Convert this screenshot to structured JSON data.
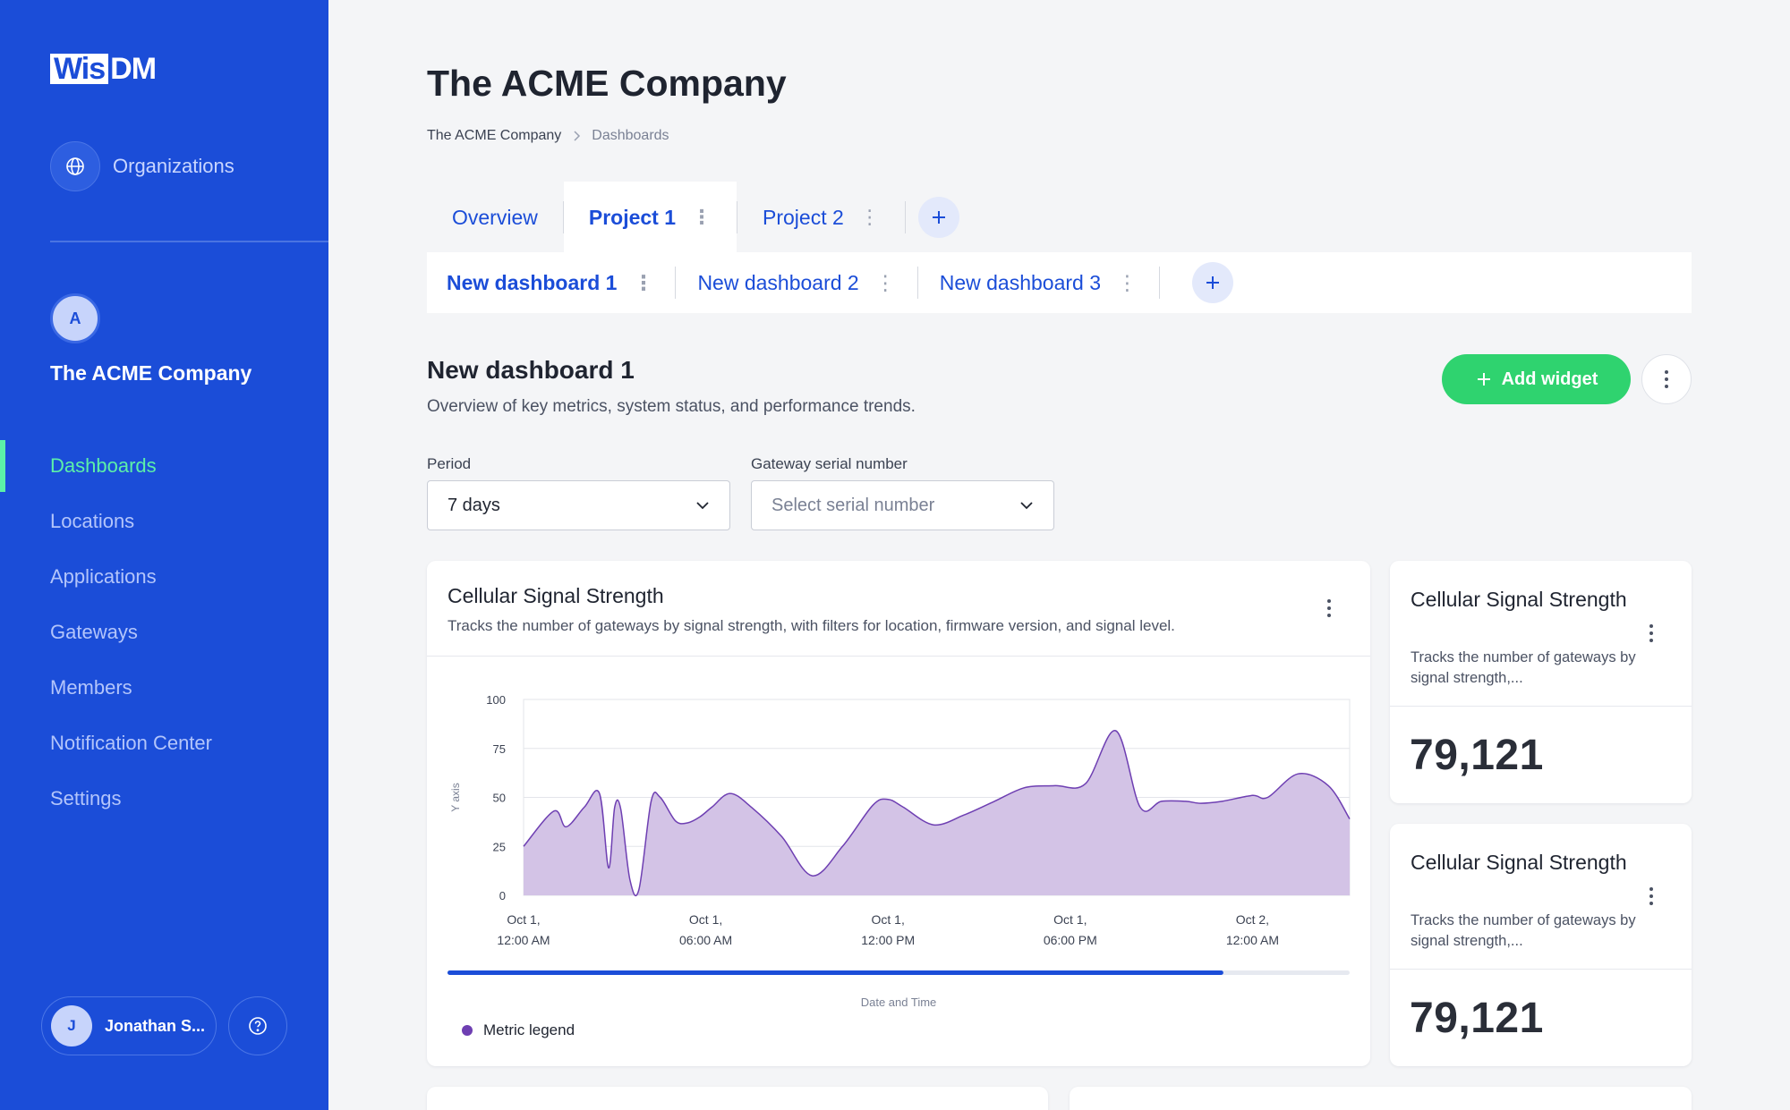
{
  "sidebar": {
    "logo_box": "Wis",
    "logo_rest": "DM",
    "organizations_label": "Organizations",
    "company_initial": "A",
    "company_name": "The ACME Company",
    "nav": [
      {
        "label": "Dashboards",
        "active": true
      },
      {
        "label": "Locations"
      },
      {
        "label": "Applications"
      },
      {
        "label": "Gateways"
      },
      {
        "label": "Members"
      },
      {
        "label": "Notification Center"
      },
      {
        "label": "Settings"
      }
    ],
    "user_initial": "J",
    "user_name": "Jonathan S..."
  },
  "header": {
    "title": "The ACME Company",
    "breadcrumb": [
      "The ACME Company",
      "Dashboards"
    ]
  },
  "tabs": [
    {
      "label": "Overview"
    },
    {
      "label": "Project 1",
      "active": true
    },
    {
      "label": "Project 2"
    }
  ],
  "subtabs": [
    {
      "label": "New dashboard 1",
      "active": true
    },
    {
      "label": "New dashboard 2"
    },
    {
      "label": "New dashboard 3"
    }
  ],
  "dashboard": {
    "title": "New dashboard 1",
    "description": "Overview of key metrics, system status, and performance trends.",
    "add_widget_label": "Add widget"
  },
  "filters": {
    "period_label": "Period",
    "period_value": "7 days",
    "gateway_label": "Gateway serial number",
    "gateway_placeholder": "Select serial number"
  },
  "chart_widget": {
    "title": "Cellular Signal Strength",
    "description": "Tracks the number of gateways by signal strength, with filters for location, firmware version, and signal level.",
    "legend_label": "Metric legend"
  },
  "stat_widgets": [
    {
      "title": "Cellular Signal Strength",
      "description": "Tracks the number of gateways by signal strength,...",
      "value": "79,121"
    },
    {
      "title": "Cellular Signal Strength",
      "description": "Tracks the number of gateways by signal strength,...",
      "value": "79,121"
    }
  ],
  "colors": {
    "brand": "#1b4dd8",
    "accent_green": "#2fd36f",
    "active_nav": "#5cf0a8",
    "series_fill": "#d3c3e6",
    "series_line": "#6e3fb2"
  },
  "chart_data": {
    "type": "area",
    "xlabel": "Date and Time",
    "ylabel": "Y axis",
    "ylim": [
      0,
      100
    ],
    "yticks": [
      0,
      25,
      50,
      75,
      100
    ],
    "xtick_labels": [
      [
        "Oct 1,",
        "12:00 AM"
      ],
      [
        "Oct 1,",
        "06:00 AM"
      ],
      [
        "Oct 1,",
        "12:00 PM"
      ],
      [
        "Oct 1,",
        "06:00 PM"
      ],
      [
        "Oct 2,",
        "12:00 AM"
      ]
    ],
    "xlim_hours": [
      0,
      27.2
    ],
    "scrollbar_fraction": 0.86,
    "series": [
      {
        "name": "Metric legend",
        "x": [
          0,
          1,
          1.4,
          2,
          2.5,
          2.8,
          3,
          3.2,
          3.5,
          3.8,
          4.2,
          4.5,
          5,
          5.4,
          5.8,
          6.2,
          6.8,
          7.5,
          8.5,
          9.5,
          10.5,
          11.5,
          12,
          12.5,
          13.5,
          14.5,
          15.5,
          16.5,
          17.5,
          18.5,
          19.5,
          20.3,
          21,
          21.8,
          22.3,
          23,
          24,
          24.5,
          25.5,
          26.5,
          27.2
        ],
        "y": [
          25,
          43,
          35,
          45,
          52,
          14,
          45,
          44,
          8,
          3,
          48,
          50,
          38,
          37,
          40,
          45,
          52,
          45,
          30,
          10,
          25,
          46,
          49,
          45,
          36,
          41,
          48,
          55,
          56,
          57,
          84,
          45,
          48,
          48,
          47,
          48,
          51,
          50,
          62,
          56,
          39
        ]
      }
    ]
  }
}
